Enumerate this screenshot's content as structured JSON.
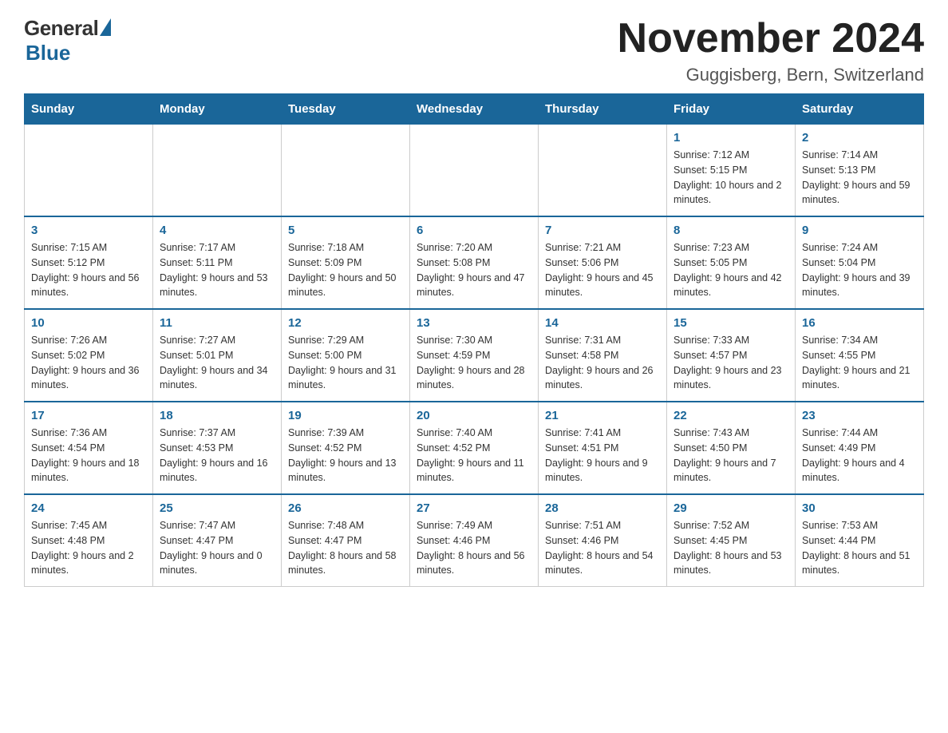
{
  "logo": {
    "general": "General",
    "blue": "Blue",
    "subtitle": "Blue"
  },
  "header": {
    "month_year": "November 2024",
    "location": "Guggisberg, Bern, Switzerland"
  },
  "weekdays": [
    "Sunday",
    "Monday",
    "Tuesday",
    "Wednesday",
    "Thursday",
    "Friday",
    "Saturday"
  ],
  "weeks": [
    [
      {
        "day": "",
        "sunrise": "",
        "sunset": "",
        "daylight": "",
        "empty": true
      },
      {
        "day": "",
        "sunrise": "",
        "sunset": "",
        "daylight": "",
        "empty": true
      },
      {
        "day": "",
        "sunrise": "",
        "sunset": "",
        "daylight": "",
        "empty": true
      },
      {
        "day": "",
        "sunrise": "",
        "sunset": "",
        "daylight": "",
        "empty": true
      },
      {
        "day": "",
        "sunrise": "",
        "sunset": "",
        "daylight": "",
        "empty": true
      },
      {
        "day": "1",
        "sunrise": "Sunrise: 7:12 AM",
        "sunset": "Sunset: 5:15 PM",
        "daylight": "Daylight: 10 hours and 2 minutes.",
        "empty": false
      },
      {
        "day": "2",
        "sunrise": "Sunrise: 7:14 AM",
        "sunset": "Sunset: 5:13 PM",
        "daylight": "Daylight: 9 hours and 59 minutes.",
        "empty": false
      }
    ],
    [
      {
        "day": "3",
        "sunrise": "Sunrise: 7:15 AM",
        "sunset": "Sunset: 5:12 PM",
        "daylight": "Daylight: 9 hours and 56 minutes.",
        "empty": false
      },
      {
        "day": "4",
        "sunrise": "Sunrise: 7:17 AM",
        "sunset": "Sunset: 5:11 PM",
        "daylight": "Daylight: 9 hours and 53 minutes.",
        "empty": false
      },
      {
        "day": "5",
        "sunrise": "Sunrise: 7:18 AM",
        "sunset": "Sunset: 5:09 PM",
        "daylight": "Daylight: 9 hours and 50 minutes.",
        "empty": false
      },
      {
        "day": "6",
        "sunrise": "Sunrise: 7:20 AM",
        "sunset": "Sunset: 5:08 PM",
        "daylight": "Daylight: 9 hours and 47 minutes.",
        "empty": false
      },
      {
        "day": "7",
        "sunrise": "Sunrise: 7:21 AM",
        "sunset": "Sunset: 5:06 PM",
        "daylight": "Daylight: 9 hours and 45 minutes.",
        "empty": false
      },
      {
        "day": "8",
        "sunrise": "Sunrise: 7:23 AM",
        "sunset": "Sunset: 5:05 PM",
        "daylight": "Daylight: 9 hours and 42 minutes.",
        "empty": false
      },
      {
        "day": "9",
        "sunrise": "Sunrise: 7:24 AM",
        "sunset": "Sunset: 5:04 PM",
        "daylight": "Daylight: 9 hours and 39 minutes.",
        "empty": false
      }
    ],
    [
      {
        "day": "10",
        "sunrise": "Sunrise: 7:26 AM",
        "sunset": "Sunset: 5:02 PM",
        "daylight": "Daylight: 9 hours and 36 minutes.",
        "empty": false
      },
      {
        "day": "11",
        "sunrise": "Sunrise: 7:27 AM",
        "sunset": "Sunset: 5:01 PM",
        "daylight": "Daylight: 9 hours and 34 minutes.",
        "empty": false
      },
      {
        "day": "12",
        "sunrise": "Sunrise: 7:29 AM",
        "sunset": "Sunset: 5:00 PM",
        "daylight": "Daylight: 9 hours and 31 minutes.",
        "empty": false
      },
      {
        "day": "13",
        "sunrise": "Sunrise: 7:30 AM",
        "sunset": "Sunset: 4:59 PM",
        "daylight": "Daylight: 9 hours and 28 minutes.",
        "empty": false
      },
      {
        "day": "14",
        "sunrise": "Sunrise: 7:31 AM",
        "sunset": "Sunset: 4:58 PM",
        "daylight": "Daylight: 9 hours and 26 minutes.",
        "empty": false
      },
      {
        "day": "15",
        "sunrise": "Sunrise: 7:33 AM",
        "sunset": "Sunset: 4:57 PM",
        "daylight": "Daylight: 9 hours and 23 minutes.",
        "empty": false
      },
      {
        "day": "16",
        "sunrise": "Sunrise: 7:34 AM",
        "sunset": "Sunset: 4:55 PM",
        "daylight": "Daylight: 9 hours and 21 minutes.",
        "empty": false
      }
    ],
    [
      {
        "day": "17",
        "sunrise": "Sunrise: 7:36 AM",
        "sunset": "Sunset: 4:54 PM",
        "daylight": "Daylight: 9 hours and 18 minutes.",
        "empty": false
      },
      {
        "day": "18",
        "sunrise": "Sunrise: 7:37 AM",
        "sunset": "Sunset: 4:53 PM",
        "daylight": "Daylight: 9 hours and 16 minutes.",
        "empty": false
      },
      {
        "day": "19",
        "sunrise": "Sunrise: 7:39 AM",
        "sunset": "Sunset: 4:52 PM",
        "daylight": "Daylight: 9 hours and 13 minutes.",
        "empty": false
      },
      {
        "day": "20",
        "sunrise": "Sunrise: 7:40 AM",
        "sunset": "Sunset: 4:52 PM",
        "daylight": "Daylight: 9 hours and 11 minutes.",
        "empty": false
      },
      {
        "day": "21",
        "sunrise": "Sunrise: 7:41 AM",
        "sunset": "Sunset: 4:51 PM",
        "daylight": "Daylight: 9 hours and 9 minutes.",
        "empty": false
      },
      {
        "day": "22",
        "sunrise": "Sunrise: 7:43 AM",
        "sunset": "Sunset: 4:50 PM",
        "daylight": "Daylight: 9 hours and 7 minutes.",
        "empty": false
      },
      {
        "day": "23",
        "sunrise": "Sunrise: 7:44 AM",
        "sunset": "Sunset: 4:49 PM",
        "daylight": "Daylight: 9 hours and 4 minutes.",
        "empty": false
      }
    ],
    [
      {
        "day": "24",
        "sunrise": "Sunrise: 7:45 AM",
        "sunset": "Sunset: 4:48 PM",
        "daylight": "Daylight: 9 hours and 2 minutes.",
        "empty": false
      },
      {
        "day": "25",
        "sunrise": "Sunrise: 7:47 AM",
        "sunset": "Sunset: 4:47 PM",
        "daylight": "Daylight: 9 hours and 0 minutes.",
        "empty": false
      },
      {
        "day": "26",
        "sunrise": "Sunrise: 7:48 AM",
        "sunset": "Sunset: 4:47 PM",
        "daylight": "Daylight: 8 hours and 58 minutes.",
        "empty": false
      },
      {
        "day": "27",
        "sunrise": "Sunrise: 7:49 AM",
        "sunset": "Sunset: 4:46 PM",
        "daylight": "Daylight: 8 hours and 56 minutes.",
        "empty": false
      },
      {
        "day": "28",
        "sunrise": "Sunrise: 7:51 AM",
        "sunset": "Sunset: 4:46 PM",
        "daylight": "Daylight: 8 hours and 54 minutes.",
        "empty": false
      },
      {
        "day": "29",
        "sunrise": "Sunrise: 7:52 AM",
        "sunset": "Sunset: 4:45 PM",
        "daylight": "Daylight: 8 hours and 53 minutes.",
        "empty": false
      },
      {
        "day": "30",
        "sunrise": "Sunrise: 7:53 AM",
        "sunset": "Sunset: 4:44 PM",
        "daylight": "Daylight: 8 hours and 51 minutes.",
        "empty": false
      }
    ]
  ]
}
